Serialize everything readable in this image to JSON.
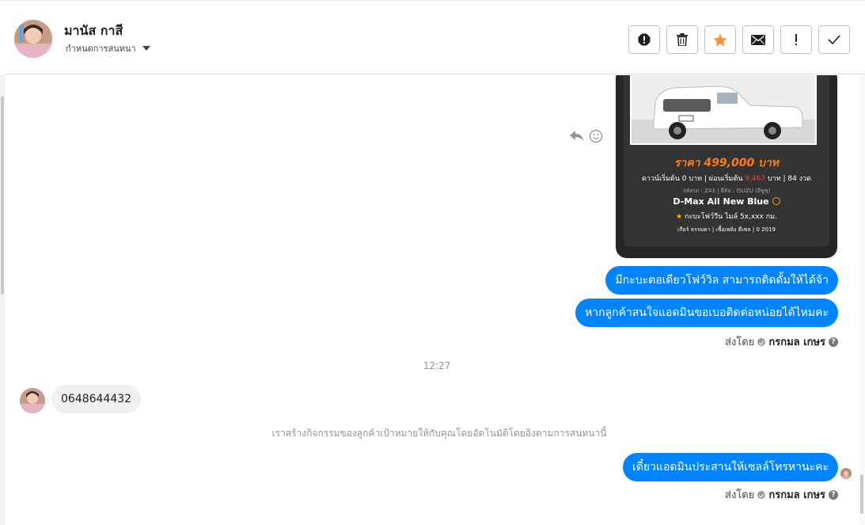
{
  "header": {
    "contact_name": "มานัส กาสี",
    "conversation_settings_label": "กำหนดการสนทนา",
    "actions": [
      "mark-spam-icon",
      "trash-icon",
      "star-icon",
      "envelope-icon",
      "exclamation-icon",
      "check-icon"
    ],
    "star_color": "#f7923a"
  },
  "card": {
    "price": "ราคา 499,000 บาท",
    "down_prefix": "ดาวน์เริ่มต้น 0 บาท | ผ่อนเริ่มต้น ",
    "installment": "9,467",
    "down_suffix": " บาท | 84 งวด",
    "details": "รหัสรถ : Z43 | ยี่ห้อ : ISUZU (อีซูซุ)",
    "model": "D-Max All New Blue",
    "feature": "กะบะโฟว์วีน ไมล์ 5x,xxx กม.",
    "specs": "เกียร์ ธรรมดา  |  เชื้อเพลิง ดีเซล  |  0 2019"
  },
  "messages": [
    {
      "text": "มีกะบะตอเดียวโฟว์วิล สามารถติดดั้มให้ได้จ้า",
      "direction": "out"
    },
    {
      "text": "หากลูกค้าสนใจแอดมินขอเบอติดต่อหน่อยได้ไหมคะ",
      "direction": "out"
    },
    {
      "text": "0648644432",
      "direction": "in"
    },
    {
      "text": "เดี๋ยวแอดมินประสานให้เซลล์โทรหานะคะ",
      "direction": "out"
    }
  ],
  "sent_by_label": "ส่งโดย",
  "agent_name": "กรกมล เกษร",
  "timestamp": "12:27",
  "system_message": "เราสร้างกิจกรรมของลูกค้าเป้าหมายให้กับคุณโดยอัตโนมัติโดยอิงตามการสนทนานี้",
  "colors": {
    "outgoing_bubble": "#0084ff",
    "incoming_bubble": "#f1f0f0"
  }
}
